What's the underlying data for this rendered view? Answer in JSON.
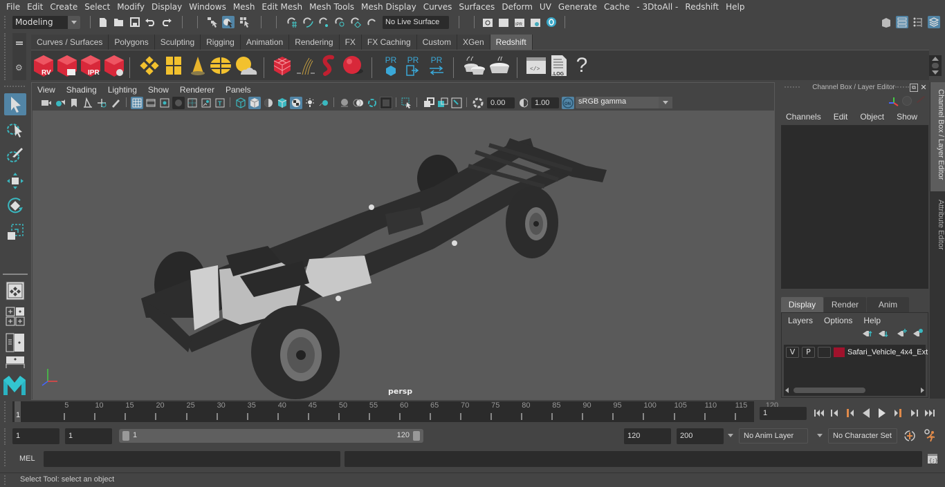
{
  "menubar": [
    "File",
    "Edit",
    "Create",
    "Select",
    "Modify",
    "Display",
    "Windows",
    "Mesh",
    "Edit Mesh",
    "Mesh Tools",
    "Mesh Display",
    "Curves",
    "Surfaces",
    "Deform",
    "UV",
    "Generate",
    "Cache",
    "- 3DtoAll -",
    "Redshift",
    "Help"
  ],
  "toolbar": {
    "workspace": "Modeling",
    "live_surface": "No Live Surface",
    "icons": [
      "new-scene-icon",
      "open-scene-icon",
      "save-scene-icon",
      "undo-icon",
      "redo-icon",
      "select-by-hierarchy-icon",
      "select-by-object-icon",
      "select-by-component-icon",
      "snap-grid-icon",
      "snap-curve-icon",
      "snap-point-icon",
      "snap-projected-center-icon",
      "snap-view-plane-icon",
      "snap-live-icon",
      "render-view-icon",
      "render-current-icon",
      "ipr-render-icon",
      "render-settings-icon",
      "hypershade-icon"
    ]
  },
  "shelf": {
    "tabs": [
      "Curves / Surfaces",
      "Polygons",
      "Sculpting",
      "Rigging",
      "Animation",
      "Rendering",
      "FX",
      "FX Caching",
      "Custom",
      "XGen",
      "Redshift"
    ],
    "active_tab": "Redshift",
    "items": [
      {
        "name": "rs-render-view",
        "label": "RV"
      },
      {
        "name": "rs-batch-render",
        "label": ""
      },
      {
        "name": "rs-ipr",
        "label": "IPR"
      },
      {
        "name": "rs-render-settings",
        "label": ""
      },
      {
        "name": "rs-light",
        "label": ""
      },
      {
        "name": "rs-area-light",
        "label": ""
      },
      {
        "name": "rs-spot-light",
        "label": ""
      },
      {
        "name": "rs-dome-light",
        "label": ""
      },
      {
        "name": "rs-sun-sky",
        "label": ""
      },
      {
        "name": "rs-proxy",
        "label": ""
      },
      {
        "name": "rs-hair",
        "label": ""
      },
      {
        "name": "rs-volume",
        "label": ""
      },
      {
        "name": "rs-sphere",
        "label": ""
      },
      {
        "name": "rs-proxy-export",
        "label": "PR"
      },
      {
        "name": "rs-proxy-import",
        "label": "PR"
      },
      {
        "name": "rs-proxy-swap",
        "label": "PR"
      },
      {
        "name": "rs-material-1",
        "label": ""
      },
      {
        "name": "rs-material-2",
        "label": ""
      },
      {
        "name": "rs-script",
        "label": ""
      },
      {
        "name": "rs-log",
        "label": ".LOG"
      },
      {
        "name": "rs-help",
        "label": "?"
      }
    ]
  },
  "viewport": {
    "menu": [
      "View",
      "Shading",
      "Lighting",
      "Show",
      "Renderer",
      "Panels"
    ],
    "exposure": "0.00",
    "gamma": "1.00",
    "color_space": "sRGB gamma",
    "color_mgmt": "ON",
    "camera": "persp"
  },
  "channel_box": {
    "title": "Channel Box / Layer Editor",
    "menu": [
      "Channels",
      "Edit",
      "Object",
      "Show"
    ],
    "layer_tabs": [
      "Display",
      "Render",
      "Anim"
    ],
    "active_layer_tab": "Display",
    "layer_menu": [
      "Layers",
      "Options",
      "Help"
    ],
    "layers": [
      {
        "v": "V",
        "p": "P",
        "color": "#a0122c",
        "name": "Safari_Vehicle_4x4_Ext"
      }
    ]
  },
  "side_tabs": [
    "Channel Box / Layer Editor",
    "Attribute Editor"
  ],
  "timeline": {
    "ticks": [
      5,
      10,
      15,
      20,
      25,
      30,
      35,
      40,
      45,
      50,
      55,
      60,
      65,
      70,
      75,
      80,
      85,
      90,
      95,
      100,
      105,
      110,
      115,
      120
    ],
    "start_label": "1",
    "current_frame": "1",
    "range_min": 1,
    "range_max": 120
  },
  "range": {
    "start": "1",
    "playback_start": "1",
    "slider_start": "1",
    "slider_end": "120",
    "playback_end": "120",
    "end": "200",
    "anim_layer": "No Anim Layer",
    "character_set": "No Character Set"
  },
  "command_line": {
    "label": "MEL",
    "value": ""
  },
  "status": "Select Tool: select an object",
  "colors": {
    "accent": "#5285a6",
    "bg": "#444444",
    "field": "#2b2b2b",
    "layer_color": "#a0122c",
    "redshift_red": "#d8283a",
    "yellow": "#f2c12e",
    "cyan": "#3aa8d8"
  }
}
